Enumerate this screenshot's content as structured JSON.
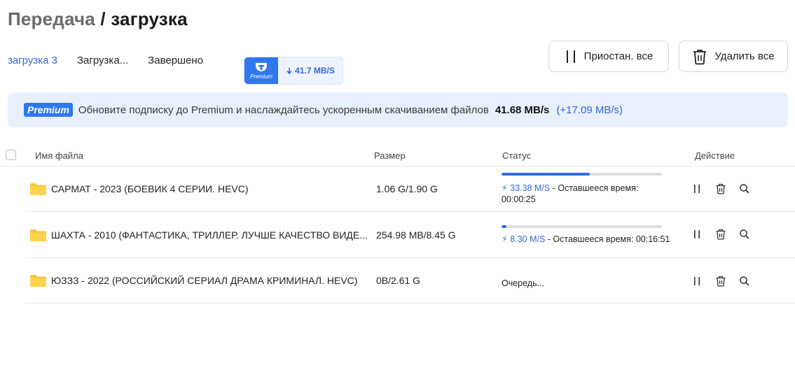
{
  "header": {
    "breadcrumb": "Передача",
    "separator": "/",
    "current": "загрузка"
  },
  "tabs": [
    {
      "label": "загрузка 3",
      "active": true
    },
    {
      "label": "Загрузка...",
      "active": false
    },
    {
      "label": "Завершено",
      "active": false
    }
  ],
  "speed_badge": {
    "icon": "premium-icon",
    "brand": "Premium",
    "speed": "41.7 MB/S"
  },
  "toolbar": {
    "pause_all_label": "Приостан. все",
    "delete_all_label": "Удалить все"
  },
  "banner": {
    "tag": "Premium",
    "message": "Обновите подписку до Premium и наслаждайтесь ускоренным скачиванием файлов",
    "speed": "41.68 MB/s",
    "extra": "(+17.09 MB/s)"
  },
  "table": {
    "columns": [
      "Имя файла",
      "Размер",
      "Статус",
      "Действие"
    ],
    "rows": [
      {
        "name": "САРМАТ - 2023 (БОЕВИК 4 СЕРИИ. HEVC)",
        "size": "1.06 G/1.90 G",
        "progress": 0.55,
        "rate": "33.38 M/S",
        "remaining_label": " - Оставшееся время:",
        "remaining_time": "00:00:25"
      },
      {
        "name": "ШАХТА - 2010 (ФАНТАСТИКА, ТРИЛЛЕР. ЛУЧШЕ КАЧЕСТВО ВИДЕ...",
        "size": "254.98 MB/8.45 G",
        "progress": 0.03,
        "rate": "8.30 M/S",
        "remaining_label": " - Оставшееся время: 00:16:51"
      },
      {
        "name": "ЮЗЗЗ - 2022 (РОССИЙСКИЙ СЕРИАЛ ДРАМА КРИМИНАЛ. HEVC)",
        "size": "0B/2.61 G",
        "status": "Очередь..."
      }
    ]
  },
  "colors": {
    "accent": "#3466d6",
    "progress": "#2f6fe0",
    "folder": "#f7c83a",
    "banner_bg": "#e9f0fd"
  }
}
